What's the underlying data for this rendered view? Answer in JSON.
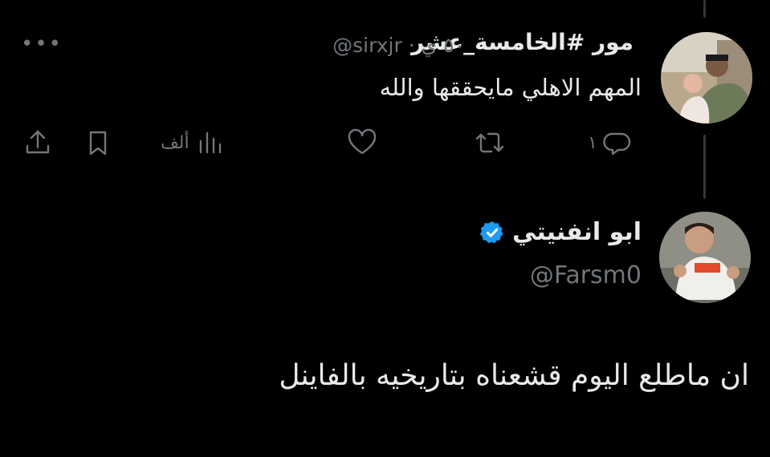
{
  "tweet_reply": {
    "display_name": "مور #الخامسة_عشر",
    "handle": "@sirxjr",
    "separator": "·",
    "time": "٥٠ ي",
    "more_label": "•••",
    "text": "المهم الاهلي مايحققها والله",
    "actions": {
      "reply_count": "١",
      "retweet_count": "",
      "like_count": "",
      "views_count": "ألف",
      "bookmark": "",
      "share": ""
    }
  },
  "quoted_tweet": {
    "display_name": "ابو انفنيتي",
    "handle": "@Farsm0",
    "verified": true,
    "text": "ان ماطلع اليوم قشعناه بتاريخيه بالفاينل"
  },
  "colors": {
    "background": "#000000",
    "primary_text": "#e7e9ea",
    "secondary_text": "#71767b",
    "verified_blue": "#1d9bf0"
  }
}
